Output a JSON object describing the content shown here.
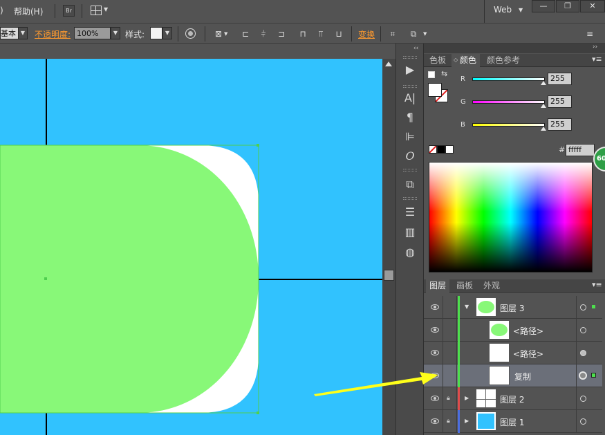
{
  "menubar": {
    "items": [
      ")",
      "帮助(H)"
    ],
    "workspace": "Web",
    "window_controls": [
      "—",
      "❐",
      "✕"
    ]
  },
  "controlbar": {
    "stroke_profile": "基本",
    "opacity_label": "不透明度:",
    "opacity_value": "100%",
    "style_label": "样式:",
    "transform_label": "变换"
  },
  "color_panel": {
    "tabs": [
      "色板",
      "颜色",
      "颜色参考"
    ],
    "active_tab": "颜色",
    "channels": [
      {
        "label": "R",
        "value": "255"
      },
      {
        "label": "G",
        "value": "255"
      },
      {
        "label": "B",
        "value": "255"
      }
    ],
    "hex_label": "#",
    "hex_value": "fffff",
    "badge": "60"
  },
  "layers_panel": {
    "tabs": [
      "图层",
      "画板",
      "外观"
    ],
    "active_tab": "图层",
    "rows": [
      {
        "name": "图层 3",
        "thumb": "green-ellipse",
        "color": "#4de04d",
        "locked": false,
        "expand": "▼",
        "selected": false
      },
      {
        "name": "<路径>",
        "thumb": "green-ellipse",
        "color": "#4de04d",
        "locked": false,
        "expand": "",
        "selected": false
      },
      {
        "name": "<路径>",
        "thumb": "white",
        "color": "#4de04d",
        "locked": false,
        "expand": "",
        "selected": false
      },
      {
        "name": "复制",
        "thumb": "white",
        "color": "#4de04d",
        "locked": false,
        "expand": "",
        "selected": true
      },
      {
        "name": "图层 2",
        "thumb": "white-grid",
        "color": "#e04c4c",
        "locked": true,
        "expand": "▶",
        "selected": false
      },
      {
        "name": "图层 1",
        "thumb": "blue",
        "color": "#4c6ee0",
        "locked": true,
        "expand": "▶",
        "selected": false
      }
    ]
  },
  "colors": {
    "artboard_bg": "#31c2fe",
    "shape_green": "#88f878",
    "annotation_arrow": "#ffff1a"
  }
}
